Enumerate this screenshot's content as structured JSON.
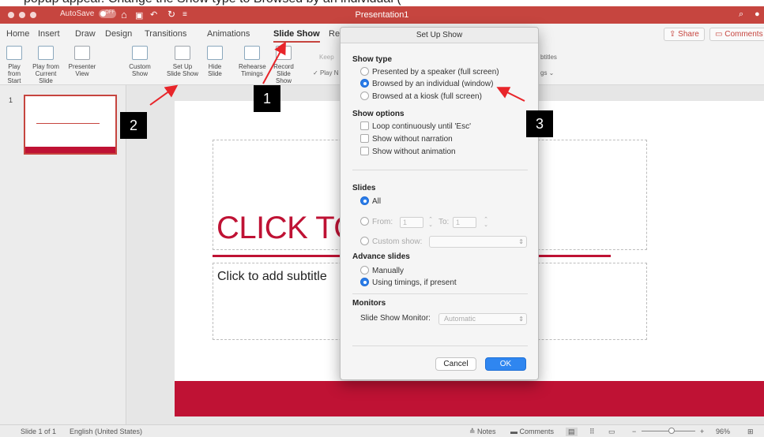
{
  "caption_fragment": "popup appear. Change the Show type to Browsed by an individual (",
  "titlebar": {
    "autosave_label": "AutoSave",
    "autosave_state": "OFF",
    "document_title": "Presentation1"
  },
  "tabs": [
    "Home",
    "Insert",
    "Draw",
    "Design",
    "Transitions",
    "Animations",
    "Slide Show",
    "Re"
  ],
  "active_tab": "Slide Show",
  "share_label": "Share",
  "comments_label": "Comments",
  "ribbon": {
    "play_from_start": "Play from Start",
    "play_from_current": "Play from Current Slide",
    "presenter_view": "Presenter View",
    "custom_show": "Custom Show",
    "set_up_slide_show": "Set Up Slide Show",
    "hide_slide": "Hide Slide",
    "rehearse": "Rehearse Timings",
    "record": "Record Slide Show",
    "keep": "Keep",
    "play": "Play N",
    "subtitles": "btitles",
    "settings": "gs"
  },
  "thumbnail": {
    "number": "1"
  },
  "slide": {
    "title": "CLICK TO",
    "subtitle": "Click to add subtitle"
  },
  "dialog": {
    "title": "Set Up Show",
    "show_type_label": "Show type",
    "show_type_options": [
      "Presented by a speaker (full screen)",
      "Browsed by an individual (window)",
      "Browsed at a kiosk (full screen)"
    ],
    "show_type_selected": 1,
    "show_options_label": "Show options",
    "show_options": [
      "Loop continuously until 'Esc'",
      "Show without narration",
      "Show without animation"
    ],
    "slides_label": "Slides",
    "slides_all": "All",
    "slides_from": "From:",
    "slides_from_value": "1",
    "slides_to": "To:",
    "slides_to_value": "1",
    "custom_show": "Custom show:",
    "advance_label": "Advance slides",
    "advance_options": [
      "Manually",
      "Using timings, if present"
    ],
    "advance_selected": 1,
    "monitors_label": "Monitors",
    "monitor_label": "Slide Show Monitor:",
    "monitor_value": "Automatic",
    "cancel": "Cancel",
    "ok": "OK"
  },
  "statusbar": {
    "slide_count": "Slide 1 of 1",
    "language": "English (United States)",
    "notes": "Notes",
    "comments": "Comments",
    "zoom": "96%"
  },
  "callouts": [
    "1",
    "2",
    "3"
  ],
  "colors": {
    "accent": "#c6453f",
    "slide_red": "#bf1234",
    "dialog_blue": "#2f86f0",
    "arrow_red": "#e8252a"
  }
}
